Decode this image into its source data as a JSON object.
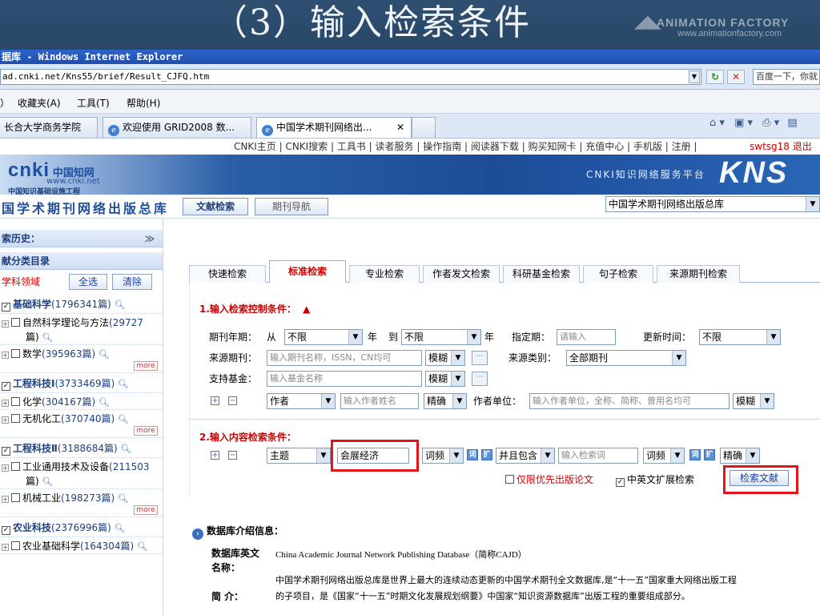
{
  "slide": {
    "title": "（3）输入检索条件",
    "logo_line1": "ANIMATION FACTORY",
    "logo_line2": "www.animationfactory.com"
  },
  "browser": {
    "window_title": "据库 - Windows Internet Explorer",
    "url": "ad.cnki.net/Kns55/brief/Result_CJFQ.htm",
    "search_placeholder": "百度一下，你就",
    "menu": [
      "）",
      "收藏夹(A)",
      "工具(T)",
      "帮助(H)"
    ],
    "tabs": [
      {
        "label": "长合大学商务学院"
      },
      {
        "label": "欢迎使用 GRID2008 数..."
      },
      {
        "label": "中国学术期刊网络出..."
      }
    ]
  },
  "topnav": {
    "links": "CNKI主页 | CNKI搜索 | 工具书 | 读者服务 | 操作指南 | 阅读器下载 | 购买知网卡 | 充值中心 | 手机版 | 注册 |",
    "user": "swtsg18  退出"
  },
  "banner": {
    "logo_main": "cnki",
    "logo_cn": "中国知网",
    "logo_url": "www.cnki.net",
    "logo_sub": "中国知识基础设施工程",
    "platform": "CNKI知识网络服务平台",
    "kns": "KNS"
  },
  "db": {
    "name": "国学术期刊网络出版总库",
    "tab_search": "文献检索",
    "tab_nav": "期刊导航",
    "selected_db": "中国学术期刊网络出版总库"
  },
  "sidebar": {
    "history": "索历史：",
    "catalog": "献分类目录",
    "field_label": "学科领域",
    "select_all": "全选",
    "clear": "清除",
    "more": "more",
    "cats": [
      {
        "type": "main",
        "name": "基础科学",
        "count": "(1796341篇)"
      },
      {
        "type": "sub",
        "name": "自然科学理论与方法",
        "count": "(29727",
        "cont": "篇)"
      },
      {
        "type": "sub",
        "name": "数学",
        "count": "(395963篇)",
        "more": true
      },
      {
        "type": "main",
        "name": "工程科技Ⅰ",
        "count": "(3733469篇)"
      },
      {
        "type": "sub",
        "name": "化学",
        "count": "(304167篇)"
      },
      {
        "type": "sub",
        "name": "无机化工",
        "count": "(370740篇)",
        "more": true
      },
      {
        "type": "main",
        "name": "工程科技Ⅱ",
        "count": "(3188684篇)"
      },
      {
        "type": "sub",
        "name": "工业通用技术及设备",
        "count": "(211503",
        "cont": "篇)"
      },
      {
        "type": "sub",
        "name": "机械工业",
        "count": "(198273篇)",
        "more": true
      },
      {
        "type": "main",
        "name": "农业科技",
        "count": "(2376996篇)"
      },
      {
        "type": "sub",
        "name": "农业基础科学",
        "count": "(164304篇)"
      }
    ]
  },
  "search_tabs": [
    "快速检索",
    "标准检索",
    "专业检索",
    "作者发文检索",
    "科研基金检索",
    "句子检索",
    "来源期刊检索"
  ],
  "control": {
    "title": "1.输入检索控制条件：",
    "year_label": "期刊年期：",
    "from": "从",
    "from_val": "不限",
    "year1": "年",
    "to": "到",
    "to_val": "不限",
    "year2": "年",
    "period_label": "指定期：",
    "period_ph": "请输入",
    "update_label": "更新时间：",
    "update_val": "不限",
    "source_label": "来源期刊：",
    "source_ph": "输入期刊名称，ISSN，CN均可",
    "fuzzy": "模糊",
    "source_type_label": "来源类别：",
    "source_type_val": "全部期刊",
    "fund_label": "支持基金：",
    "fund_ph": "输入基金名称",
    "author_field": "作者",
    "author_ph": "输入作者姓名",
    "exact": "精确",
    "unit_label": "作者单位：",
    "unit_ph": "输入作者单位，全称、简称、曾用名均可",
    "dots": "···"
  },
  "content": {
    "title": "2.输入内容检索条件：",
    "field": "主题",
    "keyword": "会展经济",
    "freq": "词频",
    "logic": "并且包含",
    "keyword2_ph": "输入检索词",
    "freq2": "词频",
    "match": "精确",
    "opt1": "仅限优先出版论文",
    "opt2": "中英文扩展检索",
    "search_btn": "检索文献"
  },
  "intro": {
    "title": "数据库介绍信息：",
    "en_label_1": "数据库英文",
    "en_label_2": "名称：",
    "en_value": "China Academic Journal Network Publishing Database（简称CAJD）",
    "desc_label": "简  介：",
    "desc_1": "中国学术期刊网络出版总库是世界上最大的连续动态更新的中国学术期刊全文数据库,是“十一五”国家重大网络出版工程",
    "desc_2": "的子项目，是《国家“十一五”时期文化发展规划纲要》中国家“知识资源数据库”出版工程的重要组成部分。"
  }
}
